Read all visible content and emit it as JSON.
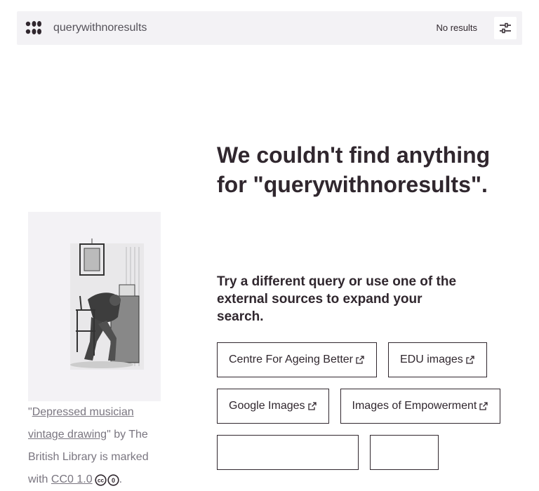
{
  "header": {
    "logo_icon": "openverse-logo-icon",
    "search_value": "querywithnoresults",
    "result_count": "No results",
    "filter_icon": "sliders-icon"
  },
  "main": {
    "heading": "We couldn't find anything for \"querywithnoresults\".",
    "subheading": "Try a different query or use one of the external sources to expand your search.",
    "sources": [
      {
        "label": "Centre For Ageing Better"
      },
      {
        "label": "EDU images"
      },
      {
        "label": "Google Images"
      },
      {
        "label": "Images of Empowerment"
      },
      {
        "label": ""
      },
      {
        "label": ""
      }
    ]
  },
  "illustration": {
    "quote_open": "\"",
    "title_link": "Depressed musician vintage drawing",
    "by_text": "\" by The British Library is marked with ",
    "license_link": "CC0 1.0",
    "license_icons": [
      "cc-icon",
      "zero-icon"
    ],
    "period": "."
  },
  "colors": {
    "text": "#30272e",
    "header_bg": "#f3f2f5",
    "muted": "#7a7680"
  }
}
